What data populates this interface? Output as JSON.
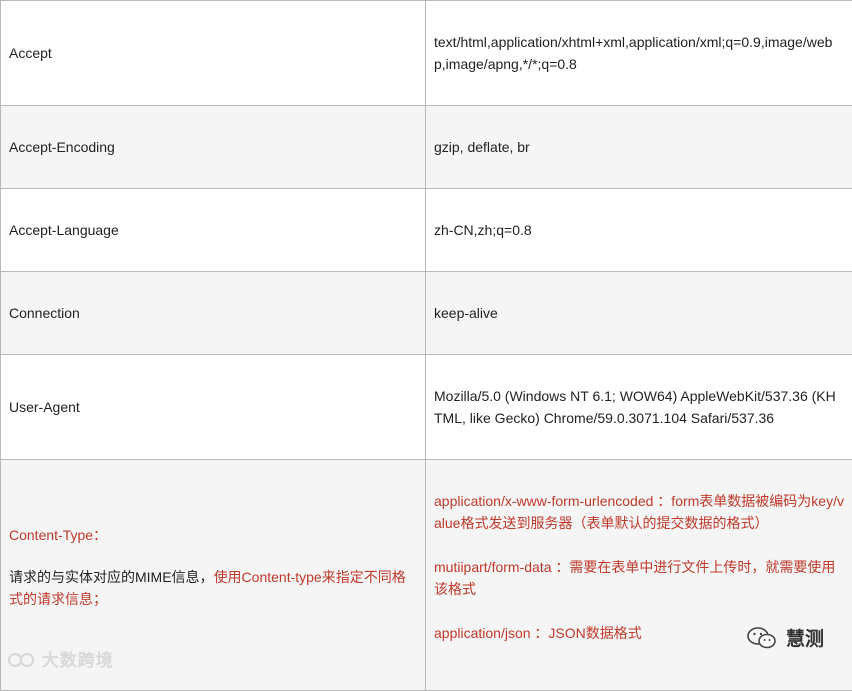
{
  "rows": [
    {
      "name": "Accept",
      "value": "text/html,application/xhtml+xml,application/xml;q=0.9,image/webp,image/apng,*/*;q=0.8"
    },
    {
      "name": "Accept-Encoding",
      "value": "gzip, deflate, br"
    },
    {
      "name": "Accept-Language",
      "value": "zh-CN,zh;q=0.8"
    },
    {
      "name": "Connection",
      "value": "keep-alive"
    },
    {
      "name": "User-Agent",
      "value": "Mozilla/5.0 (Windows NT 6.1; WOW64) AppleWebKit/537.36 (KHTML, like Gecko) Chrome/59.0.3071.104 Safari/537.36"
    }
  ],
  "content_type": {
    "name": "Content-Type：",
    "desc_prefix": "请求的与实体对应的MIME信息，",
    "desc_suffix": "使用Content-type来指定不同格式的请求信息；",
    "values": [
      "application/x-www-form-urlencoded ：form表单数据被编码为key/value格式发送到服务器（表单默认的提交数据的格式）",
      "mutiipart/form-data ：需要在表单中进行文件上传时，就需要使用该格式",
      "application/json ：JSON数据格式"
    ]
  },
  "watermarks": {
    "left": "大数跨境",
    "right": "慧测"
  }
}
